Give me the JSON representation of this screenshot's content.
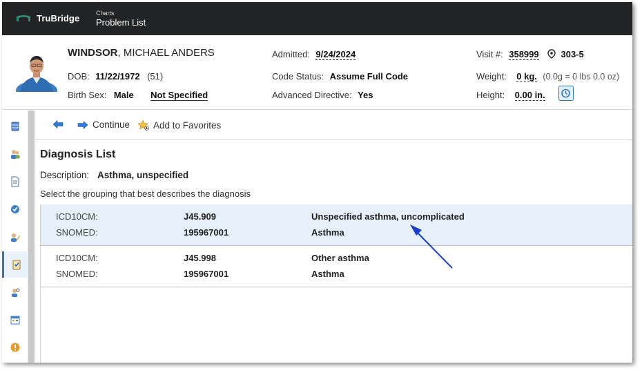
{
  "app": {
    "brand": "TruBridge",
    "breadcrumb_parent": "Charts",
    "page_name": "Problem List"
  },
  "patient": {
    "last_name": "WINDSOR",
    "first_names": ", MICHAEL ANDERS",
    "dob_label": "DOB:",
    "dob": "11/22/1972",
    "age": "(51)",
    "birth_sex_label": "Birth Sex:",
    "birth_sex": "Male",
    "gender_identity": "Not Specified",
    "admitted_label": "Admitted:",
    "admitted": "9/24/2024",
    "code_status_label": "Code Status:",
    "code_status": "Assume Full Code",
    "adv_directive_label": "Advanced Directive:",
    "adv_directive": "Yes",
    "visit_label": "Visit #:",
    "visit": "358999",
    "room": "303-5",
    "weight_label": "Weight:",
    "weight": "0 kg.",
    "weight_detail": "(0.0g = 0 lbs 0.0 oz)",
    "height_label": "Height:",
    "height": "0.00 in."
  },
  "nav": {
    "items": [
      {
        "name": "database-icon"
      },
      {
        "name": "users-icon"
      },
      {
        "name": "document-icon"
      },
      {
        "name": "clipboard-check-icon"
      },
      {
        "name": "edit-user-icon"
      },
      {
        "name": "problem-list-icon"
      },
      {
        "name": "user-search-icon"
      },
      {
        "name": "calendar-form-icon"
      },
      {
        "name": "alert-icon"
      }
    ]
  },
  "toolbar": {
    "continue_label": "Continue",
    "favorites_label": "Add to Favorites"
  },
  "main": {
    "title": "Diagnosis List",
    "description_label": "Description:",
    "description_value": "Asthma, unspecified",
    "instruction": "Select the grouping that best describes the diagnosis",
    "groups": [
      {
        "icd_label": "ICD10CM:",
        "icd_code": "J45.909",
        "icd_desc": "Unspecified asthma, uncomplicated",
        "snomed_label": "SNOMED:",
        "snomed_code": "195967001",
        "snomed_desc": "Asthma"
      },
      {
        "icd_label": "ICD10CM:",
        "icd_code": "J45.998",
        "icd_desc": "Other asthma",
        "snomed_label": "SNOMED:",
        "snomed_code": "195967001",
        "snomed_desc": "Asthma"
      }
    ]
  },
  "colors": {
    "topbar": "#222426",
    "selected_row": "#e5f0fb",
    "accent": "#2a77c8",
    "annotation_arrow": "#1a3ccf"
  }
}
